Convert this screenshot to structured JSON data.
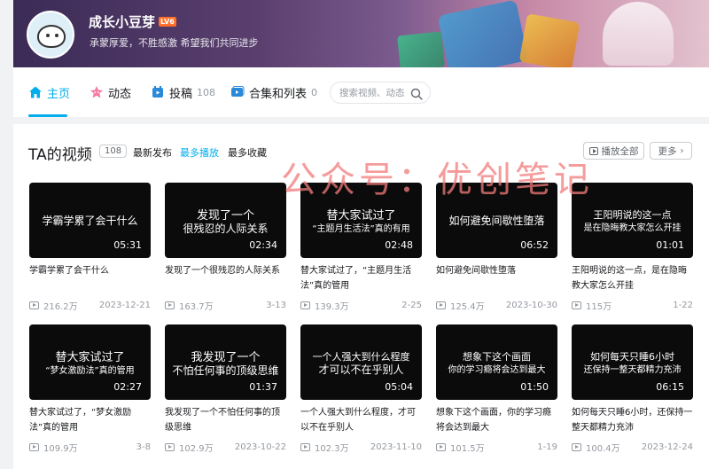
{
  "profile": {
    "username": "成长小豆芽",
    "level": "LV6",
    "bio": "承蒙厚爱，不胜感激 希望我们共同进步"
  },
  "nav": {
    "items": [
      {
        "label": "主页",
        "count": ""
      },
      {
        "label": "动态",
        "count": ""
      },
      {
        "label": "投稿",
        "count": "108"
      },
      {
        "label": "合集和列表",
        "count": "0"
      }
    ],
    "search_placeholder": "搜索视频、动态"
  },
  "videos_section": {
    "title": "TA的视频",
    "count": "108",
    "sort_tabs": [
      "最新发布",
      "最多播放",
      "最多收藏"
    ],
    "play_all": "播放全部",
    "more": "更多"
  },
  "watermark": "公众号：优创笔记",
  "colors": {
    "accent": "#00aeec",
    "level_badge": "#ff6e2a",
    "watermark": "#f27a7a"
  },
  "videos": [
    {
      "thumb_line1": "学霸学累了会干什么",
      "thumb_line2": "",
      "duration": "05:31",
      "title": "学霸学累了会干什么",
      "views": "216.2万",
      "date": "2023-12-21"
    },
    {
      "thumb_line1": "发现了一个",
      "thumb_line2": "很残忍的人际关系",
      "duration": "02:34",
      "title": "发现了一个很残忍的人际关系",
      "views": "163.7万",
      "date": "3-13"
    },
    {
      "thumb_line1": "替大家试过了",
      "thumb_line2": "“主题月生活法”真的有用",
      "duration": "02:48",
      "title": "替大家试过了，“主题月生活法”真的管用",
      "views": "139.3万",
      "date": "2-25"
    },
    {
      "thumb_line1": "如何避免间歇性堕落",
      "thumb_line2": "",
      "duration": "06:52",
      "title": "如何避免间歇性堕落",
      "views": "125.4万",
      "date": "2023-10-30"
    },
    {
      "thumb_line1": "王阳明说的这一点",
      "thumb_line2": "是在隐晦教大家怎么开挂",
      "duration": "01:01",
      "title": "王阳明说的这一点，是在隐晦教大家怎么开挂",
      "views": "115万",
      "date": "1-22"
    },
    {
      "thumb_line1": "替大家试过了",
      "thumb_line2": "“梦女激励法”真的管用",
      "duration": "02:27",
      "title": "替大家试过了，“梦女激励法”真的管用",
      "views": "109.9万",
      "date": "3-8"
    },
    {
      "thumb_line1": "我发现了一个",
      "thumb_line2": "不怕任何事的顶级思维",
      "duration": "01:37",
      "title": "我发现了一个不怕任何事的顶级思维",
      "views": "102.9万",
      "date": "2023-10-22"
    },
    {
      "thumb_line1": "一个人强大到什么程度",
      "thumb_line2": "才可以不在乎别人",
      "duration": "05:04",
      "title": "一个人强大到什么程度，才可以不在乎别人",
      "views": "102.3万",
      "date": "2023-11-10"
    },
    {
      "thumb_line1": "想象下这个画面",
      "thumb_line2": "你的学习瘾将会达到最大",
      "duration": "01:50",
      "title": "想象下这个画面，你的学习瘾将会达到最大",
      "views": "101.5万",
      "date": "1-19"
    },
    {
      "thumb_line1": "如何每天只睡6小时",
      "thumb_line2": "还保持一整天都精力充沛",
      "duration": "06:15",
      "title": "如何每天只睡6小时，还保持一整天都精力充沛",
      "views": "100.4万",
      "date": "2023-12-24"
    }
  ]
}
